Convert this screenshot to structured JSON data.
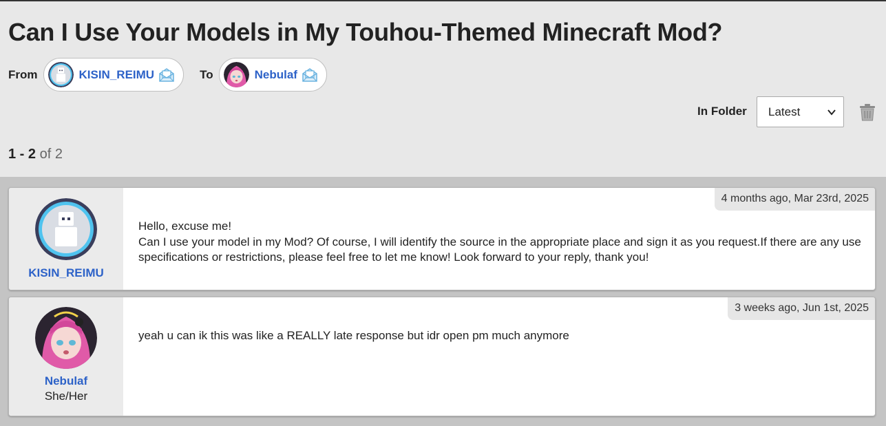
{
  "thread": {
    "title": "Can I Use Your Models in My Touhou-Themed Minecraft Mod?",
    "from_label": "From",
    "to_label": "To",
    "from_user": "KISIN_REIMU",
    "to_user": "Nebulaf"
  },
  "folder": {
    "label": "In Folder",
    "selected": "Latest"
  },
  "pagination": {
    "range": "1 - 2",
    "of_text": "of 2"
  },
  "messages": [
    {
      "author": "KISIN_REIMU",
      "pronouns": "",
      "date": "4 months ago, Mar 23rd, 2025",
      "lines": [
        "Hello, excuse me!",
        "Can I use your model in my Mod? Of course, I will identify the source in the appropriate place and sign it as you request.If there are any use specifications or restrictions, please feel free to let me know! Look forward to your reply, thank you!"
      ]
    },
    {
      "author": "Nebulaf",
      "pronouns": "She/Her",
      "date": "3 weeks ago, Jun 1st, 2025",
      "lines": [
        "yeah u can ik this was like a REALLY late response but idr open pm much anymore"
      ]
    }
  ],
  "icons": {
    "mail": "envelope-open-icon",
    "trash": "trash-icon",
    "select": "chevron-down-icon"
  },
  "colors": {
    "link": "#2d62c8",
    "page_bg": "#e8e8e8"
  }
}
